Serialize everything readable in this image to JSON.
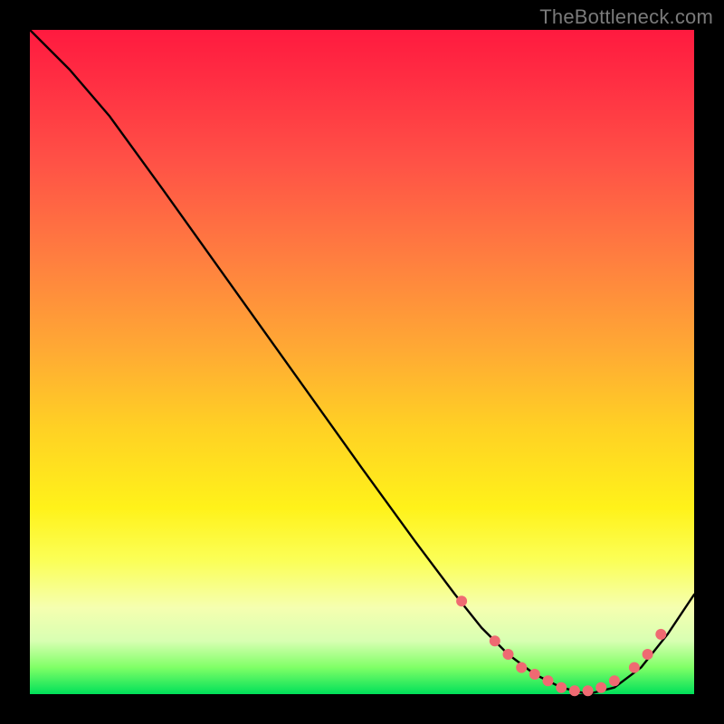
{
  "attribution": "TheBottleneck.com",
  "chart_data": {
    "type": "line",
    "title": "",
    "xlabel": "",
    "ylabel": "",
    "xlim": [
      0,
      100
    ],
    "ylim": [
      0,
      100
    ],
    "background_gradient": {
      "stops": [
        {
          "pos": 0,
          "color": "#ff1a3f"
        },
        {
          "pos": 20,
          "color": "#ff5246"
        },
        {
          "pos": 48,
          "color": "#ffa934"
        },
        {
          "pos": 72,
          "color": "#fff21a"
        },
        {
          "pos": 92,
          "color": "#d8ffb2"
        },
        {
          "pos": 100,
          "color": "#00e05a"
        }
      ]
    },
    "series": [
      {
        "name": "bottleneck-curve",
        "color": "#000000",
        "x": [
          0,
          6,
          12,
          20,
          30,
          40,
          50,
          58,
          64,
          68,
          72,
          76,
          80,
          84,
          88,
          92,
          96,
          100
        ],
        "y": [
          100,
          94,
          87,
          76,
          62,
          48,
          34,
          23,
          15,
          10,
          6,
          3,
          1,
          0,
          1,
          4,
          9,
          15
        ]
      }
    ],
    "markers": {
      "name": "highlighted-points",
      "color": "#ef6a72",
      "radius": 6,
      "points": [
        {
          "x": 65,
          "y": 14
        },
        {
          "x": 70,
          "y": 8
        },
        {
          "x": 72,
          "y": 6
        },
        {
          "x": 74,
          "y": 4
        },
        {
          "x": 76,
          "y": 3
        },
        {
          "x": 78,
          "y": 2
        },
        {
          "x": 80,
          "y": 1
        },
        {
          "x": 82,
          "y": 0.5
        },
        {
          "x": 84,
          "y": 0.5
        },
        {
          "x": 86,
          "y": 1
        },
        {
          "x": 88,
          "y": 2
        },
        {
          "x": 91,
          "y": 4
        },
        {
          "x": 93,
          "y": 6
        },
        {
          "x": 95,
          "y": 9
        }
      ]
    }
  }
}
